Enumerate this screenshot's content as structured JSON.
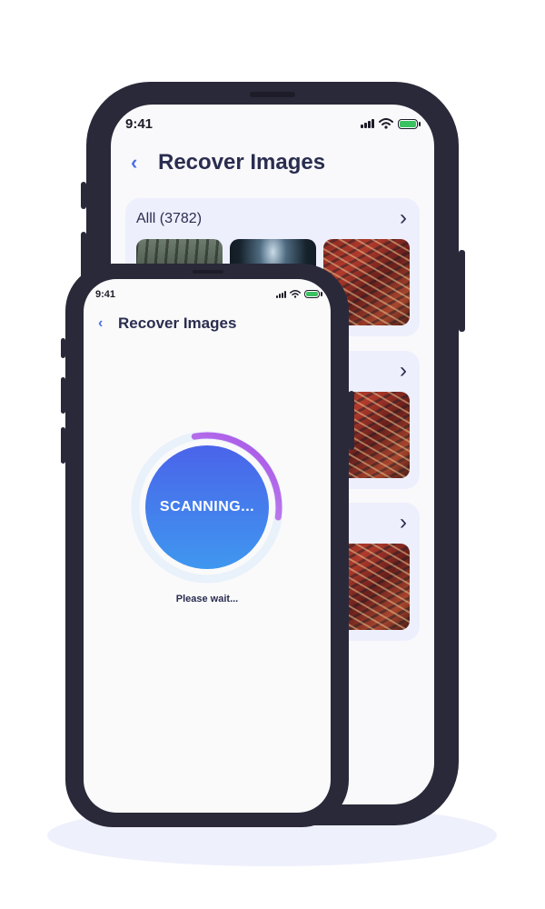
{
  "back_screen": {
    "status_time": "9:41",
    "title": "Recover Images",
    "albums": [
      {
        "label": "Alll (3782)"
      },
      {
        "label": ""
      },
      {
        "label": ""
      }
    ]
  },
  "front_screen": {
    "status_time": "9:41",
    "title": "Recover Images",
    "scan_label": "SCANNING...",
    "wait_label": "Please wait...",
    "progress_fraction": 0.3
  },
  "colors": {
    "accent_blue": "#4d6fe8",
    "progress_purple": "#b76ee8",
    "battery_green": "#3ac160",
    "phone_frame": "#2a2939"
  },
  "icons": [
    "back-chevron-icon",
    "chevron-right-icon",
    "signal-icon",
    "wifi-icon",
    "battery-icon"
  ]
}
